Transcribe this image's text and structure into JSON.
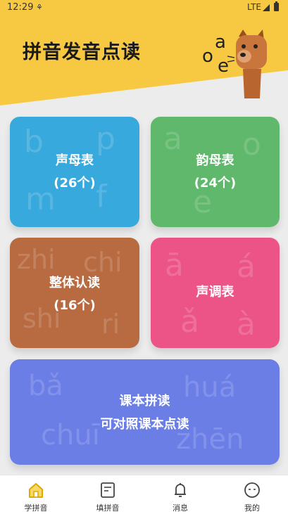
{
  "status": {
    "time": "12:29",
    "network": "LTE"
  },
  "header": {
    "title": "拼音发音点读",
    "mascot_letters": [
      "o",
      "a",
      "e"
    ]
  },
  "cards": [
    {
      "id": "initials",
      "line1": "声母表",
      "line2": "(26个)",
      "deco": [
        "b",
        "p",
        "m",
        "f"
      ],
      "color": "#38a9dc"
    },
    {
      "id": "finals",
      "line1": "韵母表",
      "line2": "(24个)",
      "deco": [
        "a",
        "o",
        "e"
      ],
      "color": "#5fb86b"
    },
    {
      "id": "whole",
      "line1": "整体认读",
      "line2": "(16个)",
      "deco": [
        "zhi",
        "chi",
        "shi",
        "ri"
      ],
      "color": "#b86b41"
    },
    {
      "id": "tones",
      "line1": "声调表",
      "deco": [
        "ā",
        "á",
        "ǎ",
        "à"
      ],
      "color": "#ec5488"
    },
    {
      "id": "textbook",
      "line1": "课本拼读",
      "line2": "可对照课本点读",
      "deco": [
        "bǎ",
        "huá",
        "chuī",
        "zhēn"
      ],
      "color": "#6a7ee6"
    }
  ],
  "tabs": [
    {
      "label": "学拼音",
      "icon": "home-icon",
      "active": true
    },
    {
      "label": "填拼音",
      "icon": "form-icon"
    },
    {
      "label": "消息",
      "icon": "bell-icon"
    },
    {
      "label": "我的",
      "icon": "profile-icon"
    }
  ],
  "colors": {
    "header_yellow": "#f7c942",
    "background": "#ececec",
    "tab_active": "#f7c942"
  }
}
